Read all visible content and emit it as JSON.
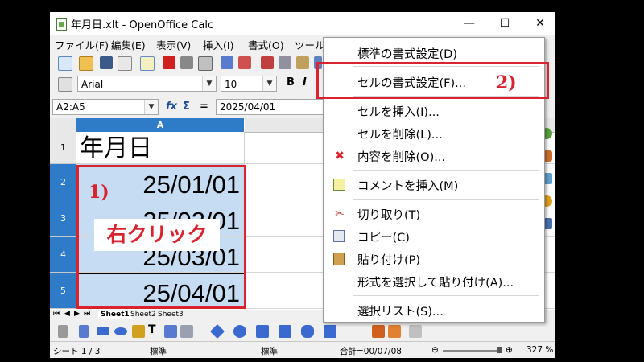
{
  "window": {
    "title": "年月日.xlt - OpenOffice Calc",
    "minimize_glyph": "—",
    "maximize_glyph": "☐",
    "close_glyph": "✕"
  },
  "menubar": [
    "ファイル(F)",
    "編集(E)",
    "表示(V)",
    "挿入(I)",
    "書式(O)",
    "ツール("
  ],
  "format_toolbar": {
    "font_name": "Arial",
    "font_size": "10",
    "bold": "B",
    "italic": "I"
  },
  "formula_bar": {
    "name_box": "A2:A5",
    "input": "2025/04/01"
  },
  "grid": {
    "column_header": "A",
    "rows": [
      {
        "num": "1",
        "value": "年月日"
      },
      {
        "num": "2",
        "value": "25/01/01"
      },
      {
        "num": "3",
        "value": "25/02/01"
      },
      {
        "num": "4",
        "value": "25/03/01"
      },
      {
        "num": "5",
        "value": "25/04/01"
      }
    ]
  },
  "sheet_tabs": [
    "Sheet1",
    "Sheet2",
    "Sheet3"
  ],
  "statusbar": {
    "sheet": "シート 1 / 3",
    "style": "標準",
    "mode": "標準",
    "sum": "合計=00/07/08",
    "zoom": "327 %"
  },
  "context_menu": [
    {
      "label": "標準の書式設定(D)",
      "icon": ""
    },
    {
      "label": "セルの書式設定(F)...",
      "icon": ""
    },
    {
      "label": "セルを挿入(I)...",
      "icon": ""
    },
    {
      "label": "セルを削除(L)...",
      "icon": ""
    },
    {
      "label": "内容を削除(O)...",
      "icon": "delete-x-icon"
    },
    {
      "label": "コメントを挿入(M)",
      "icon": "comment-icon"
    },
    {
      "label": "切り取り(T)",
      "icon": "scissors-icon"
    },
    {
      "label": "コピー(C)",
      "icon": "copy-icon"
    },
    {
      "label": "貼り付け(P)",
      "icon": "paste-icon"
    },
    {
      "label": "形式を選択して貼り付け(A)...",
      "icon": ""
    },
    {
      "label": "選択リスト(S)...",
      "icon": ""
    }
  ],
  "annotations": {
    "step1": "1)",
    "step2": "2)",
    "right_click": "右クリック"
  },
  "colors": {
    "accent": "#d9232e",
    "selection": "#c5dcf2",
    "header_selected": "#2e7cc8"
  }
}
